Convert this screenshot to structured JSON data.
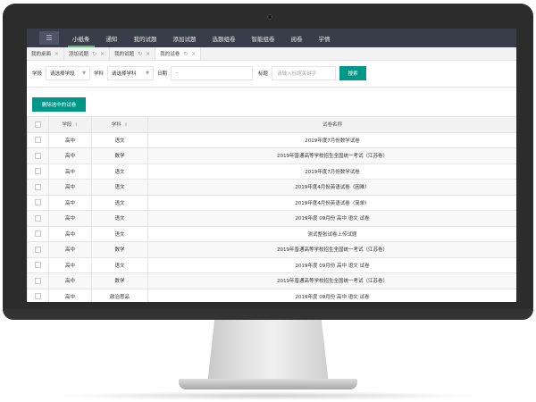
{
  "nav": {
    "menu_icon": "menu-icon",
    "items": [
      {
        "label": "小纸条",
        "active": true
      },
      {
        "label": "通知"
      },
      {
        "label": "我的试题"
      },
      {
        "label": "添加试题"
      },
      {
        "label": "选题组卷"
      },
      {
        "label": "智能组卷"
      },
      {
        "label": "阅卷"
      },
      {
        "label": "学情"
      }
    ]
  },
  "tabs": [
    {
      "label": "我的桌面",
      "close": "×"
    },
    {
      "label": "添加试题",
      "refresh": "↻",
      "close": "×"
    },
    {
      "label": "我的试题",
      "refresh": "↻",
      "close": "×"
    },
    {
      "label": "我的试卷",
      "refresh": "↻",
      "close": "×",
      "active": true
    }
  ],
  "filters": {
    "stage_label": "学段",
    "stage_value": "请选择学段",
    "subject_label": "学科",
    "subject_value": "请选择学科",
    "date_label": "日期",
    "date_value": "-",
    "title_label": "标题",
    "title_placeholder": "请输入标题关键字",
    "search_button": "搜索"
  },
  "delete_button": "删除选中的试卷",
  "table": {
    "headers": {
      "stage": "学段",
      "subject": "学科",
      "name": "试卷名称"
    },
    "sort_glyph": "⇕",
    "rows": [
      {
        "stage": "高中",
        "subject": "语文",
        "name": "2019年度7月份数学试卷"
      },
      {
        "stage": "高中",
        "subject": "数学",
        "name": "2019年普通高等学校招生全国统一考试（江苏卷）"
      },
      {
        "stage": "高中",
        "subject": "语文",
        "name": "2019年度7月份数学试卷"
      },
      {
        "stage": "高中",
        "subject": "语文",
        "name": "2019年度4月份英语试卷（困难）"
      },
      {
        "stage": "高中",
        "subject": "语文",
        "name": "2019年度4月份英语试卷（简单）"
      },
      {
        "stage": "高中",
        "subject": "语文",
        "name": "2019年度 09月份 高中 语文 试卷"
      },
      {
        "stage": "高中",
        "subject": "语文",
        "name": "测试整张试卷上传试题"
      },
      {
        "stage": "高中",
        "subject": "数学",
        "name": "2019年普通高等学校招生全国统一考试（江苏卷）"
      },
      {
        "stage": "高中",
        "subject": "语文",
        "name": "2019年度 09月份 高中 语文 试卷"
      },
      {
        "stage": "高中",
        "subject": "数学",
        "name": "2019年普通高等学校招生全国统一考试（江苏卷）"
      },
      {
        "stage": "高中",
        "subject": "政治思品",
        "name": "2019年度 09月份 高中 语文 试卷"
      }
    ]
  },
  "colors": {
    "nav_bg": "#393d49",
    "accent_green": "#009688",
    "nav_active_underline": "#5fb878",
    "monitor_bezel": "#2c2c2c"
  }
}
